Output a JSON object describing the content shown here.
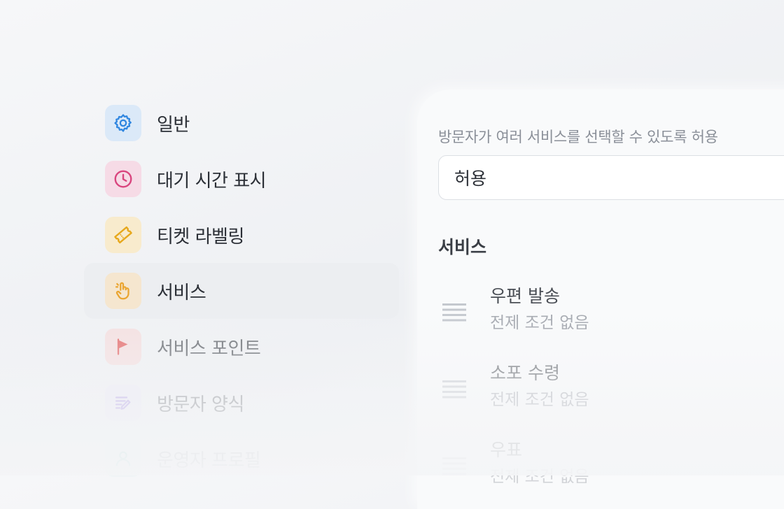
{
  "sidebar": {
    "items": [
      {
        "label": "일반",
        "icon": "gear-icon",
        "color": "#2f86e0",
        "bg": "#dbe9f8"
      },
      {
        "label": "대기 시간 표시",
        "icon": "clock-icon",
        "color": "#d9457e",
        "bg": "#f6dbe6"
      },
      {
        "label": "티켓 라벨링",
        "icon": "ticket-icon",
        "color": "#e7a81c",
        "bg": "#f8ebcd"
      },
      {
        "label": "서비스",
        "icon": "pointer-hand-icon",
        "color": "#eaa531",
        "bg": "#f5e6cf"
      },
      {
        "label": "서비스 포인트",
        "icon": "flag-icon",
        "color": "#e45b5b",
        "bg": "#f6dede"
      },
      {
        "label": "방문자 양식",
        "icon": "form-edit-icon",
        "color": "#9b7fe0",
        "bg": "#ece8f8"
      },
      {
        "label": "운영자 프로필",
        "icon": "user-icon",
        "color": "#37b0a0",
        "bg": "#e0f2ef"
      }
    ]
  },
  "panel": {
    "field_label": "방문자가 여러 서비스를 선택할 수 있도록 허용",
    "select_value": "허용",
    "section_title": "서비스",
    "services": [
      {
        "name": "우편 발송",
        "condition": "전제 조건 없음"
      },
      {
        "name": "소포 수령",
        "condition": "전제 조건 없음"
      },
      {
        "name": "우표",
        "condition": "전제 조건 없음"
      }
    ]
  }
}
